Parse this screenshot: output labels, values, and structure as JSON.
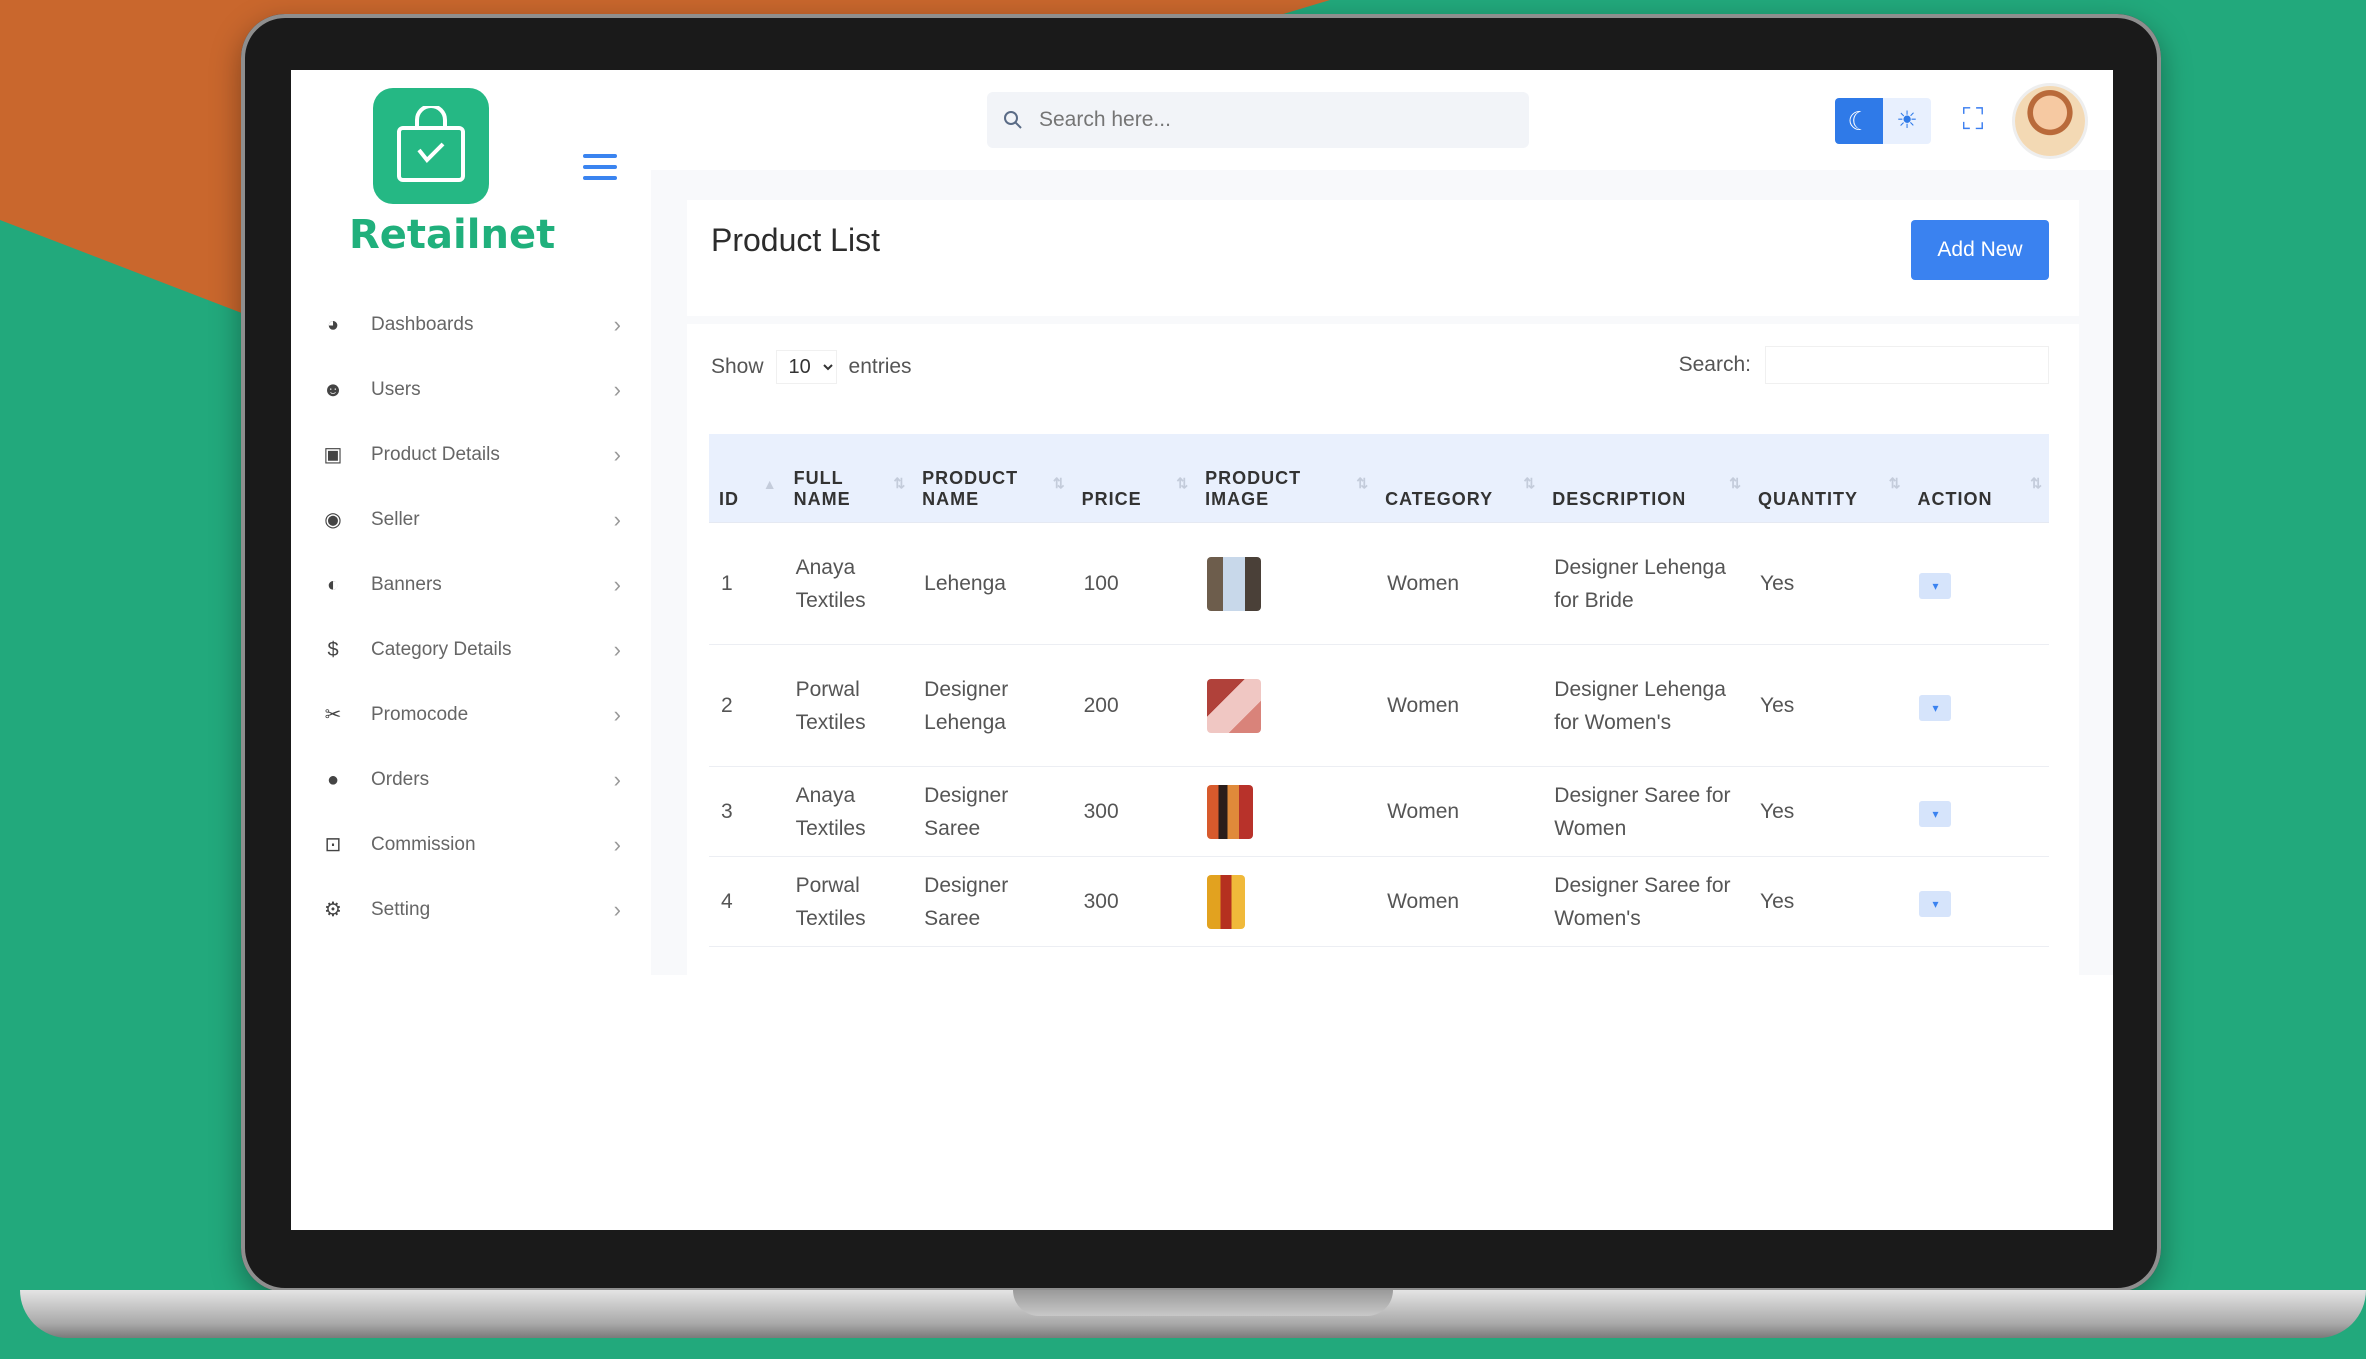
{
  "brand": {
    "name": "Retailnet",
    "accent": "#25b884"
  },
  "topbar": {
    "search_placeholder": "Search here..."
  },
  "sidebar": {
    "items": [
      {
        "label": "Dashboards",
        "icon": "dashboard-icon"
      },
      {
        "label": "Users",
        "icon": "users-icon"
      },
      {
        "label": "Product Details",
        "icon": "box-icon"
      },
      {
        "label": "Seller",
        "icon": "seller-icon"
      },
      {
        "label": "Banners",
        "icon": "banner-icon"
      },
      {
        "label": "Category Details",
        "icon": "dollar-icon"
      },
      {
        "label": "Promocode",
        "icon": "tag-icon"
      },
      {
        "label": "Orders",
        "icon": "orders-icon"
      },
      {
        "label": "Commission",
        "icon": "commission-icon"
      },
      {
        "label": "Setting",
        "icon": "gear-icon"
      }
    ]
  },
  "page": {
    "title": "Product List",
    "add_label": "Add New"
  },
  "table_controls": {
    "show_label": "Show",
    "entries_value": "10",
    "entries_label": "entries",
    "search_label": "Search:"
  },
  "table": {
    "headers": [
      "ID",
      "FULL NAME",
      "PRODUCT NAME",
      "PRICE",
      "PRODUCT IMAGE",
      "CATEGORY",
      "DESCRIPTION",
      "QUANTITY",
      "ACTION"
    ],
    "rows": [
      {
        "id": "1",
        "full_name": "Anaya Textiles",
        "product_name": "Lehenga",
        "price": "100",
        "category": "Women",
        "description": "Designer Lehenga for Bride",
        "quantity": "Yes"
      },
      {
        "id": "2",
        "full_name": "Porwal Textiles",
        "product_name": "Designer Lehenga",
        "price": "200",
        "category": "Women",
        "description": "Designer Lehenga for Women's",
        "quantity": "Yes"
      },
      {
        "id": "3",
        "full_name": "Anaya Textiles",
        "product_name": "Designer Saree",
        "price": "300",
        "category": "Women",
        "description": "Designer Saree for Women",
        "quantity": "Yes"
      },
      {
        "id": "4",
        "full_name": "Porwal Textiles",
        "product_name": "Designer Saree",
        "price": "300",
        "category": "Women",
        "description": "Designer Saree for Women's",
        "quantity": "Yes"
      }
    ]
  }
}
